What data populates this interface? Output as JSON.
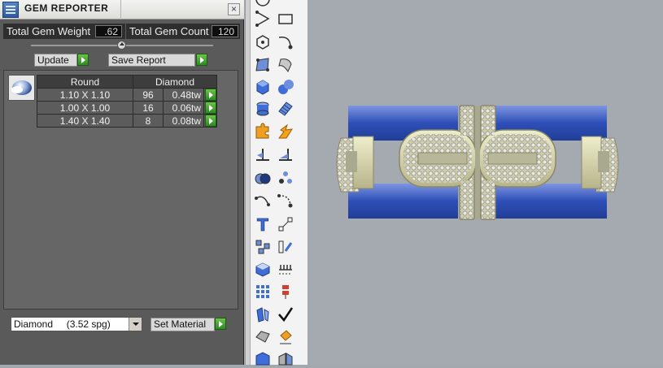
{
  "panel": {
    "title": "GEM REPORTER",
    "close": "×",
    "weight_label": "Total Gem Weight",
    "weight_value": ".62",
    "count_label": "Total Gem Count",
    "count_value": "120",
    "update_label": "Update",
    "save_label": "Save Report",
    "table": {
      "headers": [
        "Round",
        "Diamond"
      ],
      "rows": [
        {
          "size": "1.10 X 1.10",
          "count": "96",
          "tw": "0.48tw"
        },
        {
          "size": "1.00 X 1.00",
          "count": "16",
          "tw": "0.06tw"
        },
        {
          "size": "1.40 X 1.40",
          "count": "8",
          "tw": "0.08tw"
        }
      ]
    },
    "material": {
      "selected": "Diamond     (3.52 spg)"
    },
    "set_material_label": "Set Material"
  },
  "toolbar": {
    "icons": [
      "circle-icon",
      "triangle-icon",
      "rectangle-icon",
      "polygon-icon",
      "curve-icon",
      "grid-plane-icon",
      "surface-icon",
      "cube-icon",
      "spheres-icon",
      "cylinder-icon",
      "mesh-icon",
      "puzzle-icon",
      "explode-icon",
      "split-icon",
      "cut-icon",
      "boolean-icon",
      "dots-icon",
      "arc-icon",
      "node-arc-icon",
      "text-icon",
      "connect-icon",
      "group-icon",
      "align-icon",
      "box-icon",
      "table-icon",
      "grid-icon",
      "scale-icon",
      "mirror-icon",
      "checkmark-icon",
      "shape-icon",
      "paint-icon",
      "block-icon",
      "split-block-icon"
    ]
  },
  "viewport": {
    "object": "ring-3d-model"
  },
  "colors": {
    "accent_green": "#3aa02c",
    "panel_bg": "#5a5a5a",
    "viewport_bg": "#a5a9b0",
    "ring_blue": "#3a5cc2",
    "ring_gold": "#d8d6a8"
  }
}
